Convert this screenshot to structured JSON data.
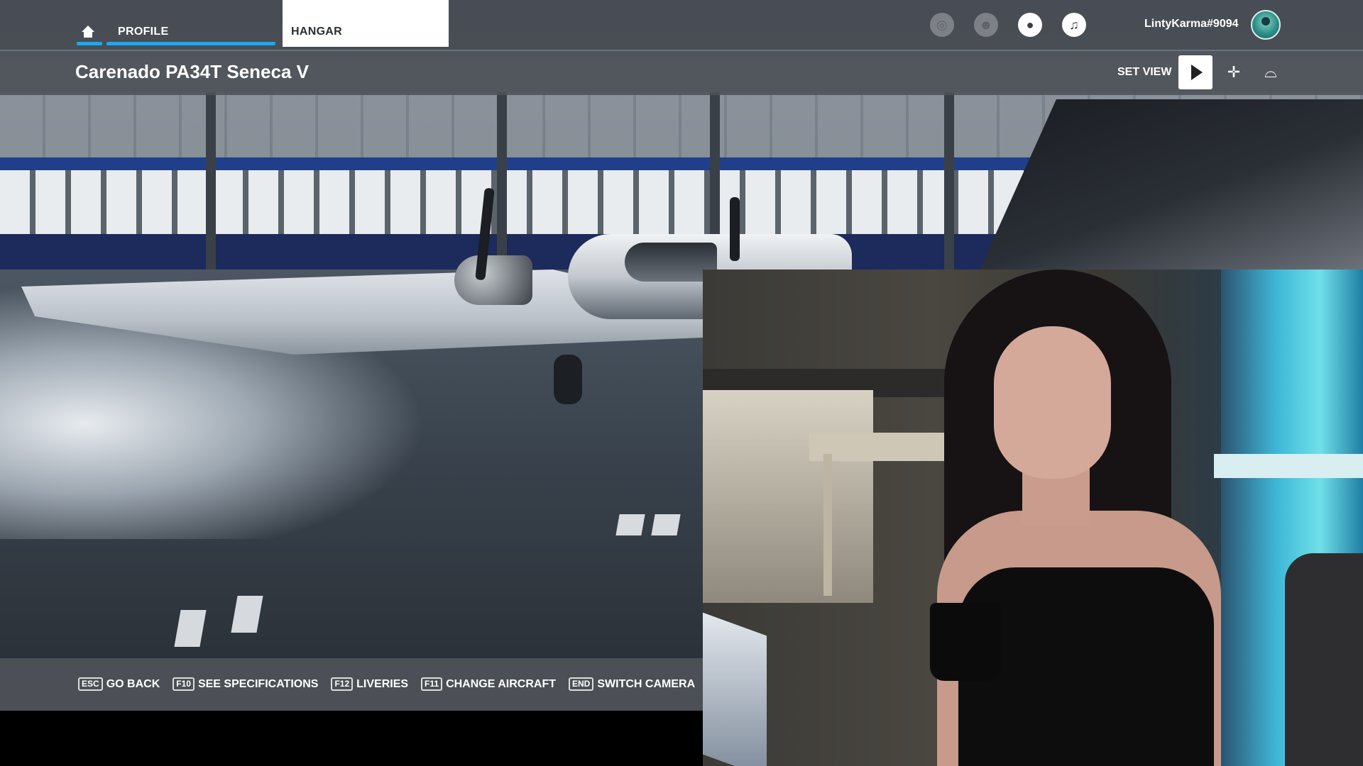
{
  "nav": {
    "tabs": [
      {
        "label": "PROFILE",
        "active": true
      },
      {
        "label": "HANGAR",
        "active": false
      }
    ],
    "icons": [
      "achievements-icon",
      "friends-icon",
      "profile-icon",
      "notifications-icon"
    ],
    "username": "LintyKarma#9094",
    "accent_color": "#19a8f0"
  },
  "header": {
    "aircraft_title": "Carenado PA34T Seneca V",
    "set_view_label": "SET VIEW",
    "view_icons": [
      "play-icon",
      "cross-view-icon",
      "side-view-icon"
    ]
  },
  "hints": [
    {
      "key": "ESC",
      "label": "GO BACK"
    },
    {
      "key": "F10",
      "label": "SEE SPECIFICATIONS"
    },
    {
      "key": "F12",
      "label": "LIVERIES"
    },
    {
      "key": "F11",
      "label": "CHANGE AIRCRAFT"
    },
    {
      "key": "END",
      "label": "SWITCH CAMERA"
    }
  ]
}
